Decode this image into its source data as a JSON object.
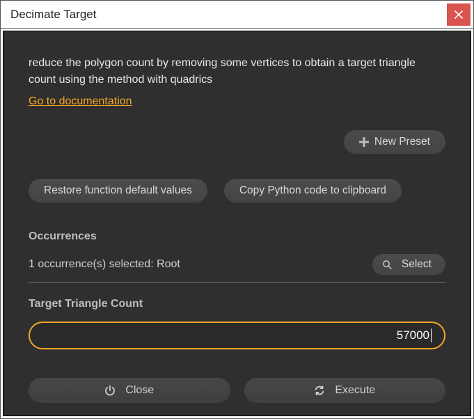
{
  "window": {
    "title": "Decimate Target"
  },
  "description": "reduce the polygon count by removing some vertices to obtain a target triangle count using the method with quadrics",
  "doc_link": "Go to documentation",
  "buttons": {
    "new_preset": "New Preset",
    "restore_defaults": "Restore function default values",
    "copy_python": "Copy Python code to clipboard",
    "select": "Select",
    "close": "Close",
    "execute": "Execute"
  },
  "sections": {
    "occurrences_label": "Occurrences",
    "occurrences_status": "1 occurrence(s) selected: Root",
    "target_label": "Target Triangle Count"
  },
  "inputs": {
    "target_value": "57000"
  },
  "colors": {
    "accent": "#f5a623",
    "panel_bg": "#2f2f2f",
    "close_bg": "#d9534f"
  }
}
